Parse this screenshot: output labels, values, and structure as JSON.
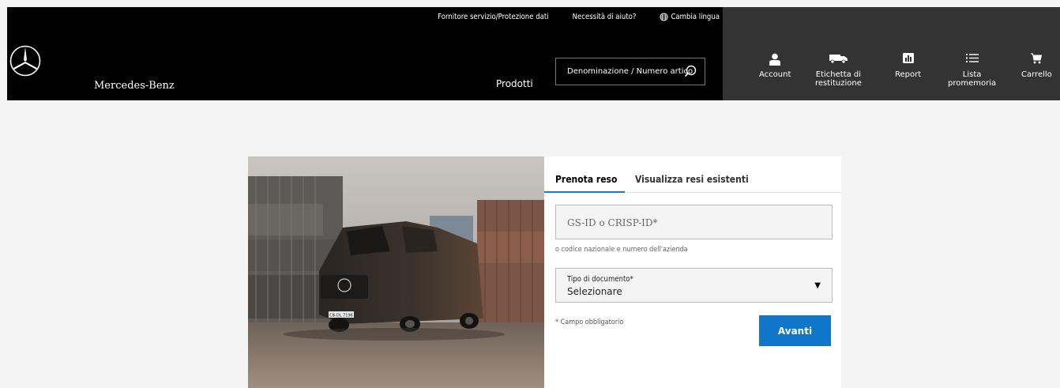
{
  "header": {
    "top_links": {
      "provider": "Fornitore servizio/Protezione dati",
      "help": "Necessità di aiuto?",
      "language": "Cambia lingua"
    },
    "brand": "Mercedes-Benz",
    "products": "Prodotti",
    "search_placeholder": "Denominazione / Numero articolo",
    "nav": {
      "account": "Account",
      "return_label_line1": "Etichetta di",
      "return_label_line2": "restituzione",
      "report": "Report",
      "wishlist_line1": "Lista",
      "wishlist_line2": "promemoria",
      "cart": "Carrello"
    }
  },
  "hero": {
    "plate": "CB-DL 7196"
  },
  "panel": {
    "tabs": [
      "Prenota reso",
      "Visualizza resi esistenti"
    ],
    "id_placeholder": "GS-ID o CRISP-ID*",
    "id_hint": "o codice nazionale e numero dell'azienda",
    "doc_type_label": "Tipo di documento*",
    "doc_type_value": "Selezionare",
    "required_note": "* Campo obbligatorio",
    "next_button": "Avanti"
  },
  "colors": {
    "header_black": "#000000",
    "header_gray": "#333333",
    "accent_blue": "#0f76c9"
  }
}
